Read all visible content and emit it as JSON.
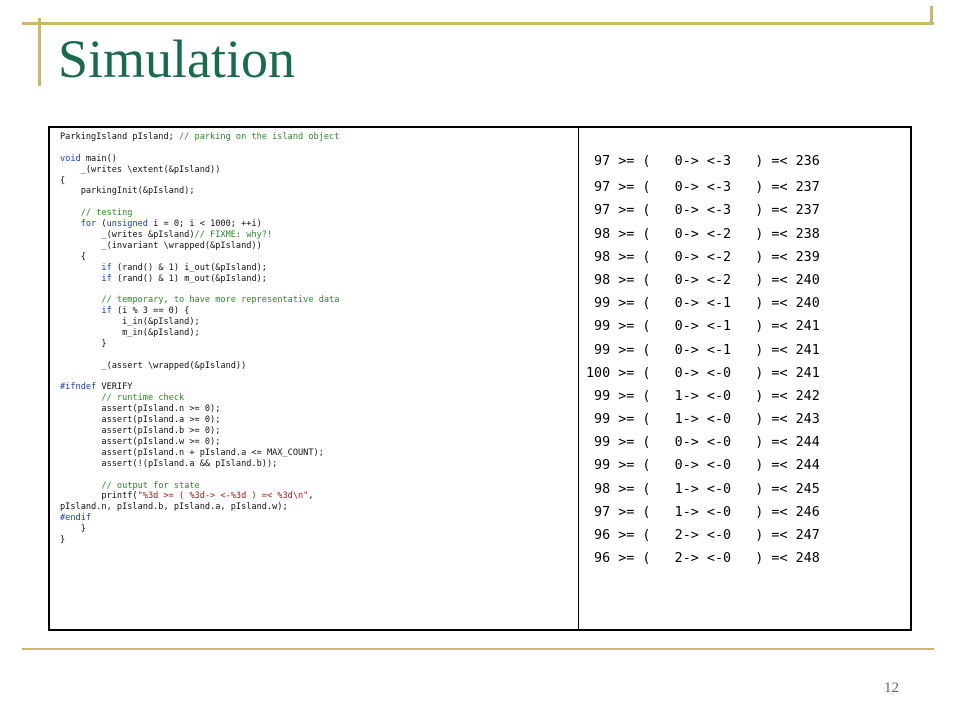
{
  "slide": {
    "title": "Simulation",
    "page_number": "12"
  },
  "code_lines": [
    [
      {
        "t": "ParkingIsland pIsland; "
      },
      {
        "t": "// parking on the island object",
        "c": "cm"
      }
    ],
    [],
    [
      {
        "t": "void",
        "c": "kw"
      },
      {
        "t": " main()"
      }
    ],
    [
      {
        "t": "    _(writes \\extent(&pIsland))"
      }
    ],
    [
      {
        "t": "{"
      }
    ],
    [
      {
        "t": "    parkingInit(&pIsland);"
      }
    ],
    [],
    [
      {
        "t": "    "
      },
      {
        "t": "// testing",
        "c": "cm"
      }
    ],
    [
      {
        "t": "    "
      },
      {
        "t": "for",
        "c": "kw"
      },
      {
        "t": " ("
      },
      {
        "t": "unsigned",
        "c": "kw"
      },
      {
        "t": " i = 0; i < 1000; ++i)"
      }
    ],
    [
      {
        "t": "        _(writes &pIsland)"
      },
      {
        "t": "// FIXME: why?!",
        "c": "cm"
      }
    ],
    [
      {
        "t": "        _(invariant \\wrapped(&pIsland))"
      }
    ],
    [
      {
        "t": "    {"
      }
    ],
    [
      {
        "t": "        "
      },
      {
        "t": "if",
        "c": "kw"
      },
      {
        "t": " (rand() & 1) i_out(&pIsland);"
      }
    ],
    [
      {
        "t": "        "
      },
      {
        "t": "if",
        "c": "kw"
      },
      {
        "t": " (rand() & 1) m_out(&pIsland);"
      }
    ],
    [],
    [
      {
        "t": "        "
      },
      {
        "t": "// temporary, to have more representative data",
        "c": "cm"
      }
    ],
    [
      {
        "t": "        "
      },
      {
        "t": "if",
        "c": "kw"
      },
      {
        "t": " (i % 3 == 0) {"
      }
    ],
    [
      {
        "t": "            i_in(&pIsland);"
      }
    ],
    [
      {
        "t": "            m_in(&pIsland);"
      }
    ],
    [
      {
        "t": "        }"
      }
    ],
    [],
    [
      {
        "t": "        _(assert \\wrapped(&pIsland))"
      }
    ],
    [],
    [
      {
        "t": "#ifndef",
        "c": "kw"
      },
      {
        "t": " VERIFY"
      }
    ],
    [
      {
        "t": "        "
      },
      {
        "t": "// runtime check",
        "c": "cm"
      }
    ],
    [
      {
        "t": "        assert(pIsland.n >= 0);"
      }
    ],
    [
      {
        "t": "        assert(pIsland.a >= 0);"
      }
    ],
    [
      {
        "t": "        assert(pIsland.b >= 0);"
      }
    ],
    [
      {
        "t": "        assert(pIsland.w >= 0);"
      }
    ],
    [
      {
        "t": "        assert(pIsland.n + pIsland.a <= MAX_COUNT);"
      }
    ],
    [
      {
        "t": "        assert(!(pIsland.a && pIsland.b));"
      }
    ],
    [],
    [
      {
        "t": "        "
      },
      {
        "t": "// output for state",
        "c": "cm"
      }
    ],
    [
      {
        "t": "        printf("
      },
      {
        "t": "\"%3d >= ( %3d-> <-%3d ) =< %3d\\n\"",
        "c": "st"
      },
      {
        "t": ","
      }
    ],
    [
      {
        "t": "pIsland.n, pIsland.b, pIsland.a, pIsland.w);"
      }
    ],
    [
      {
        "t": "#endif",
        "c": "kw"
      }
    ],
    [
      {
        "t": "    }"
      }
    ],
    [
      {
        "t": "}"
      }
    ]
  ],
  "output_lines": [
    " 97 >= (   0-> <-3   ) =< 236",
    " 97 >= (   0-> <-3   ) =< 237",
    " 97 >= (   0-> <-3   ) =< 237",
    " 98 >= (   0-> <-2   ) =< 238",
    " 98 >= (   0-> <-2   ) =< 239",
    " 98 >= (   0-> <-2   ) =< 240",
    " 99 >= (   0-> <-1   ) =< 240",
    " 99 >= (   0-> <-1   ) =< 241",
    " 99 >= (   0-> <-1   ) =< 241",
    "100 >= (   0-> <-0   ) =< 241",
    " 99 >= (   1-> <-0   ) =< 242",
    " 99 >= (   1-> <-0   ) =< 243",
    " 99 >= (   0-> <-0   ) =< 244",
    " 99 >= (   0-> <-0   ) =< 244",
    " 98 >= (   1-> <-0   ) =< 245",
    " 97 >= (   1-> <-0   ) =< 246",
    " 96 >= (   2-> <-0   ) =< 247",
    " 96 >= (   2-> <-0   ) =< 248"
  ]
}
